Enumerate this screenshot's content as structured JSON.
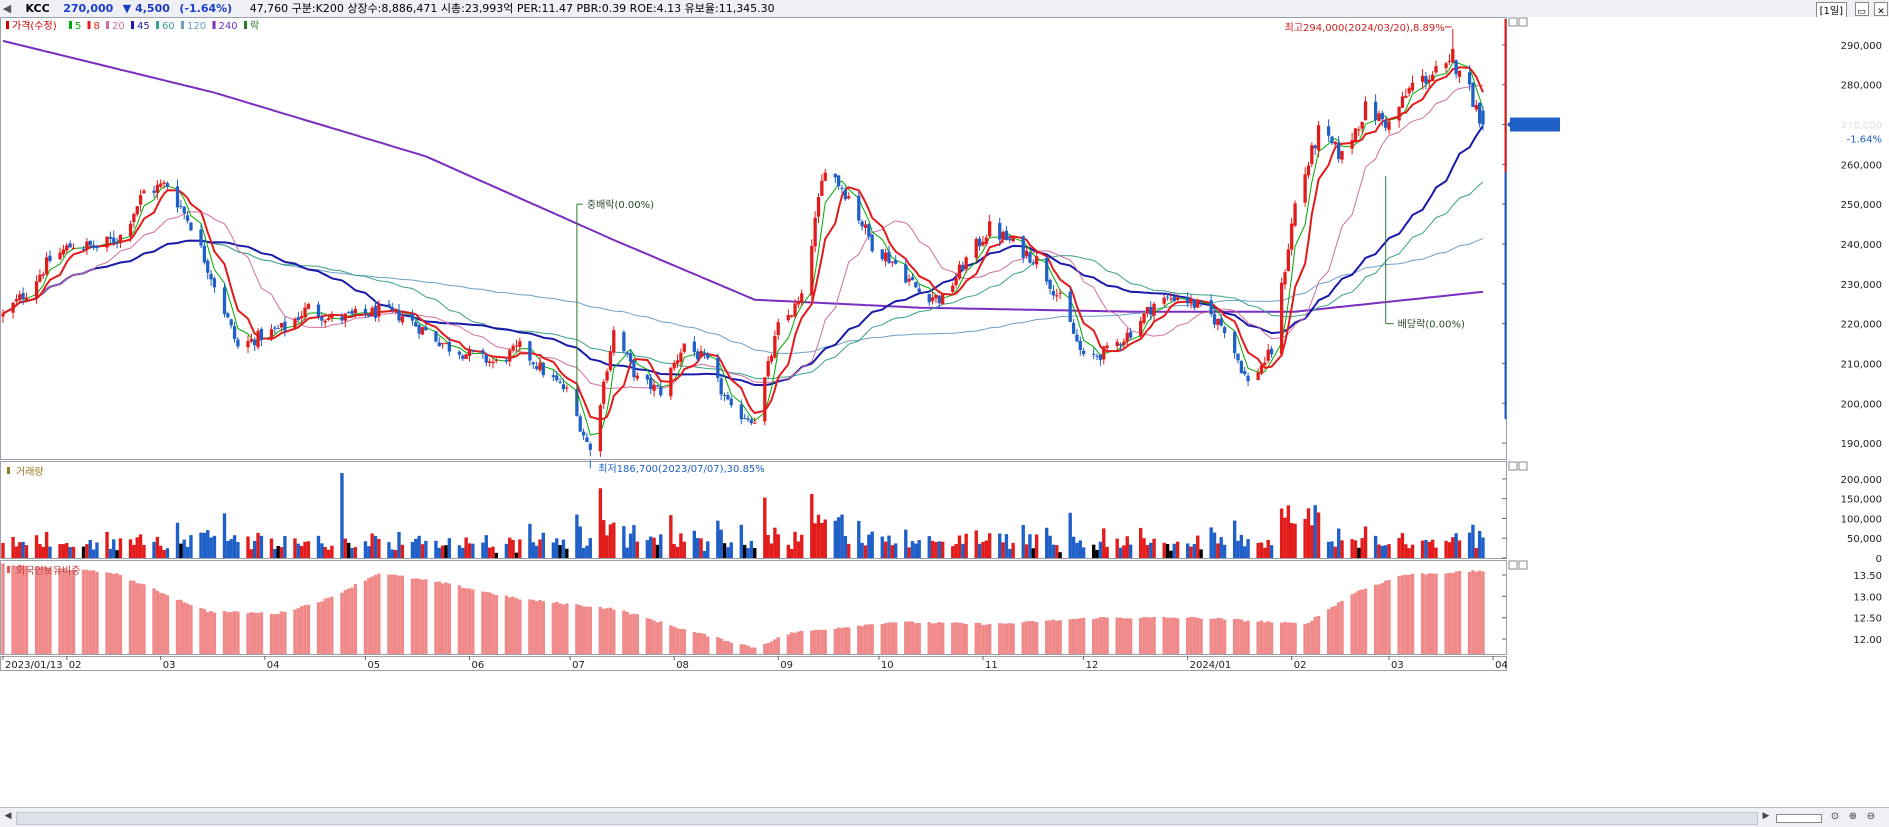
{
  "header": {
    "nav_left": "◀",
    "name": "KCC",
    "price": "270,000",
    "change": "▼ 4,500",
    "change_pct": "(-1.64%)",
    "info": "47,760  구분:K200  상장수:8,886,471  시총:23,993억  PER:11.47  PBR:0.39  ROE:4.13  유보율:11,345.30",
    "period": "[1일]",
    "btn_min": "▭",
    "btn_close": "✕"
  },
  "price_panel": {
    "legend": [
      {
        "label": "가격(수정)",
        "color": "#cc0000",
        "icon": "candle-icon"
      },
      {
        "label": "5",
        "color": "#00aa00"
      },
      {
        "label": "8",
        "color": "#e21b1b"
      },
      {
        "label": "20",
        "color": "#d070a0"
      },
      {
        "label": "45",
        "color": "#1a1aaa"
      },
      {
        "label": "60",
        "color": "#3aa08a"
      },
      {
        "label": "120",
        "color": "#6aa0c8"
      },
      {
        "label": "240",
        "color": "#7a2ec0"
      },
      {
        "label": "락",
        "color": "#2a7a2a"
      }
    ],
    "y_ticks": [
      "290,000",
      "280,000",
      "270,000",
      "260,000",
      "250,000",
      "240,000",
      "230,000",
      "220,000",
      "210,000",
      "200,000",
      "190,000"
    ],
    "current_price_tag": "270,000",
    "current_change_tag": "-1.64%",
    "annotations": {
      "high": "최고294,000(2024/03/20),8.89%",
      "low": "최저186,700(2023/07/07),30.85%",
      "jungbae": "중배락(0.00%)",
      "baedang": "배당락(0.00%)"
    }
  },
  "volume_panel": {
    "title": "거래량",
    "y_ticks": [
      "200,000",
      "150,000",
      "100,000",
      "50,000",
      "0"
    ]
  },
  "foreign_panel": {
    "title": "외국인보유비중",
    "y_ticks": [
      "13.50",
      "13.00",
      "12.50",
      "12.00"
    ]
  },
  "x_axis_labels": [
    "2023/01/13",
    "02",
    "03",
    "04",
    "05",
    "06",
    "07",
    "08",
    "09",
    "10",
    "11",
    "12",
    "2024/01",
    "02",
    "03",
    "04"
  ],
  "colors": {
    "up": "#e21b1b",
    "down": "#1f5fc8",
    "vol_neutral": "#000000",
    "foreign_bar": "#f08a8a"
  },
  "chart_data": {
    "type": "candlestick",
    "title": "KCC",
    "period": "1일",
    "price_ylim": [
      186000,
      297000
    ],
    "x_start": "2023/01/13",
    "x_end": "2024/03/29",
    "weekly_close": [
      {
        "date": "2023-01-13",
        "close": 222000
      },
      {
        "date": "2023-01-20",
        "close": 228000
      },
      {
        "date": "2023-01-27",
        "close": 236000
      },
      {
        "date": "2023-02-03",
        "close": 240000
      },
      {
        "date": "2023-02-10",
        "close": 239000
      },
      {
        "date": "2023-02-17",
        "close": 242000
      },
      {
        "date": "2023-02-24",
        "close": 253000
      },
      {
        "date": "2023-03-03",
        "close": 255000
      },
      {
        "date": "2023-03-10",
        "close": 245000
      },
      {
        "date": "2023-03-17",
        "close": 230000
      },
      {
        "date": "2023-03-24",
        "close": 214000
      },
      {
        "date": "2023-03-31",
        "close": 217000
      },
      {
        "date": "2023-04-07",
        "close": 219000
      },
      {
        "date": "2023-04-14",
        "close": 224000
      },
      {
        "date": "2023-04-21",
        "close": 221000
      },
      {
        "date": "2023-04-28",
        "close": 222000
      },
      {
        "date": "2023-05-05",
        "close": 223000
      },
      {
        "date": "2023-05-12",
        "close": 222000
      },
      {
        "date": "2023-05-19",
        "close": 218000
      },
      {
        "date": "2023-05-26",
        "close": 214000
      },
      {
        "date": "2023-06-02",
        "close": 212000
      },
      {
        "date": "2023-06-09",
        "close": 210000
      },
      {
        "date": "2023-06-16",
        "close": 214000
      },
      {
        "date": "2023-06-23",
        "close": 208000
      },
      {
        "date": "2023-06-30",
        "close": 203000
      },
      {
        "date": "2023-07-07",
        "close": 188000
      },
      {
        "date": "2023-07-14",
        "close": 218000
      },
      {
        "date": "2023-07-21",
        "close": 206000
      },
      {
        "date": "2023-07-28",
        "close": 203000
      },
      {
        "date": "2023-08-04",
        "close": 215000
      },
      {
        "date": "2023-08-11",
        "close": 210000
      },
      {
        "date": "2023-08-18",
        "close": 198000
      },
      {
        "date": "2023-08-25",
        "close": 196000
      },
      {
        "date": "2023-09-01",
        "close": 219000
      },
      {
        "date": "2023-09-08",
        "close": 226000
      },
      {
        "date": "2023-09-15",
        "close": 260000
      },
      {
        "date": "2023-09-22",
        "close": 252000
      },
      {
        "date": "2023-09-29",
        "close": 240000
      },
      {
        "date": "2023-10-06",
        "close": 235000
      },
      {
        "date": "2023-10-13",
        "close": 228000
      },
      {
        "date": "2023-10-20",
        "close": 226000
      },
      {
        "date": "2023-10-27",
        "close": 236000
      },
      {
        "date": "2023-11-03",
        "close": 244000
      },
      {
        "date": "2023-11-10",
        "close": 240000
      },
      {
        "date": "2023-11-17",
        "close": 236000
      },
      {
        "date": "2023-11-24",
        "close": 226000
      },
      {
        "date": "2023-12-01",
        "close": 211000
      },
      {
        "date": "2023-12-08",
        "close": 213000
      },
      {
        "date": "2023-12-15",
        "close": 218000
      },
      {
        "date": "2023-12-22",
        "close": 225000
      },
      {
        "date": "2023-12-29",
        "close": 227000
      },
      {
        "date": "2024-01-05",
        "close": 224000
      },
      {
        "date": "2024-01-12",
        "close": 219000
      },
      {
        "date": "2024-01-19",
        "close": 205000
      },
      {
        "date": "2024-01-26",
        "close": 213000
      },
      {
        "date": "2024-02-02",
        "close": 250000
      },
      {
        "date": "2024-02-09",
        "close": 268000
      },
      {
        "date": "2024-02-16",
        "close": 262000
      },
      {
        "date": "2024-02-23",
        "close": 274000
      },
      {
        "date": "2024-03-01",
        "close": 270000
      },
      {
        "date": "2024-03-08",
        "close": 280000
      },
      {
        "date": "2024-03-15",
        "close": 283000
      },
      {
        "date": "2024-03-22",
        "close": 285000
      },
      {
        "date": "2024-03-29",
        "close": 270000
      }
    ],
    "ma_240": [
      {
        "date": "2023-01-13",
        "value": 291000
      },
      {
        "date": "2023-03-17",
        "value": 278000
      },
      {
        "date": "2023-05-19",
        "value": 262000
      },
      {
        "date": "2023-07-14",
        "value": 241000
      },
      {
        "date": "2023-08-25",
        "value": 226000
      },
      {
        "date": "2023-10-13",
        "value": 224000
      },
      {
        "date": "2023-12-15",
        "value": 223000
      },
      {
        "date": "2024-02-02",
        "value": 223000
      },
      {
        "date": "2024-03-29",
        "value": 228000
      }
    ],
    "volume_ylim": [
      0,
      230000
    ],
    "volume_peak": 215000,
    "foreign_ratio_ylim": [
      11.65,
      13.85
    ]
  }
}
